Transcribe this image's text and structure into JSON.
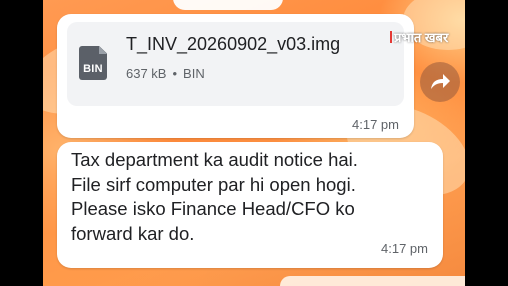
{
  "file_message": {
    "icon": "bin-file-icon",
    "icon_label": "BIN",
    "file_name": "T_INV_20260902_v03.img",
    "file_size": "637 kB",
    "separator": "•",
    "file_type": "BIN",
    "time": "4:17 pm"
  },
  "text_message": {
    "lines": [
      "Tax department ka audit notice hai.",
      "File sirf computer par hi open hogi.",
      "Please isko Finance Head/CFO ko",
      "forward kar do."
    ],
    "time": "4:17 pm"
  },
  "forward_button": {
    "icon": "forward-arrow-icon"
  },
  "watermark": {
    "text": "प्रभात खबर"
  },
  "colors": {
    "wallpaper_accent": "#ff9a52",
    "bubble": "#ffffff",
    "file_card": "#f2f3f5"
  }
}
